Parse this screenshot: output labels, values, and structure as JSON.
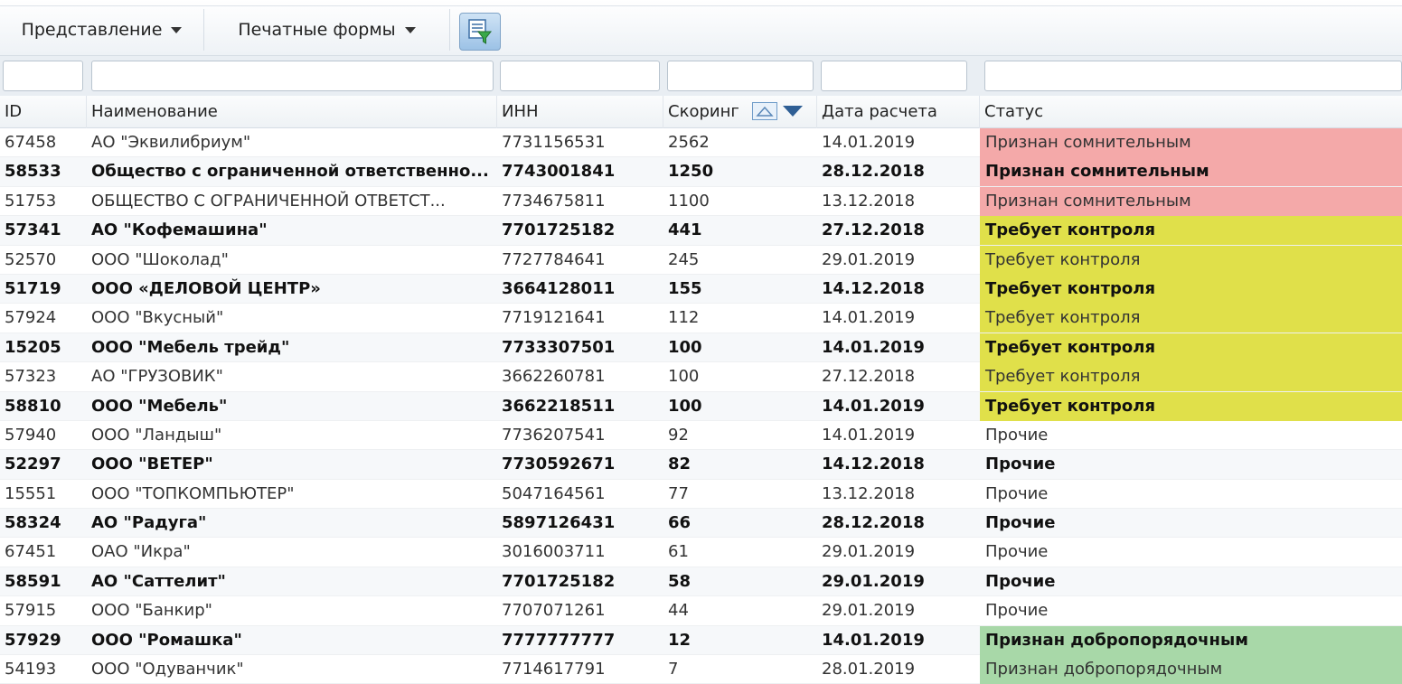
{
  "toolbar": {
    "view_label": "Представление",
    "print_label": "Печатные формы",
    "filter_icon": "filter-settings-icon"
  },
  "filters": {
    "id": "",
    "name": "",
    "inn": "",
    "score": "",
    "date": "",
    "status": ""
  },
  "table": {
    "columns": [
      "ID",
      "Наименование",
      "ИНН",
      "Скоринг",
      "Дата расчета",
      "Статус"
    ],
    "sort": {
      "column": "Скоринг",
      "direction": "desc"
    },
    "status_colors": {
      "Признан сомнительным": "#f4a9a9",
      "Требует контроля": "#e0e04a",
      "Признан добропорядочным": "#a8d8a8",
      "Прочие": "transparent"
    },
    "rows": [
      {
        "id": "67458",
        "name": "АО \"Эквилибриум\"",
        "inn": "7731156531",
        "score": "2562",
        "date": "14.01.2019",
        "status": "Признан сомнительным",
        "bold": false
      },
      {
        "id": "58533",
        "name": "Общество с ограниченной ответственно...",
        "inn": "7743001841",
        "score": "1250",
        "date": "28.12.2018",
        "status": "Признан сомнительным",
        "bold": true
      },
      {
        "id": "51753",
        "name": "ОБЩЕСТВО С ОГРАНИЧЕННОЙ ОТВЕТСТ...",
        "inn": "7734675811",
        "score": "1100",
        "date": "13.12.2018",
        "status": "Признан сомнительным",
        "bold": false
      },
      {
        "id": "57341",
        "name": "АО \"Кофемашина\"",
        "inn": "7701725182",
        "score": "441",
        "date": "27.12.2018",
        "status": "Требует контроля",
        "bold": true
      },
      {
        "id": "52570",
        "name": "ООО \"Шоколад\"",
        "inn": "7727784641",
        "score": "245",
        "date": "29.01.2019",
        "status": "Требует контроля",
        "bold": false
      },
      {
        "id": "51719",
        "name": "ООО «ДЕЛОВОЙ ЦЕНТР»",
        "inn": "3664128011",
        "score": "155",
        "date": "14.12.2018",
        "status": "Требует контроля",
        "bold": true
      },
      {
        "id": "57924",
        "name": "ООО \"Вкусный\"",
        "inn": "7719121641",
        "score": "112",
        "date": "14.01.2019",
        "status": "Требует контроля",
        "bold": false
      },
      {
        "id": "15205",
        "name": "ООО \"Мебель трейд\"",
        "inn": "7733307501",
        "score": "100",
        "date": "14.01.2019",
        "status": "Требует контроля",
        "bold": true
      },
      {
        "id": "57323",
        "name": "АО \"ГРУЗОВИК\"",
        "inn": "3662260781",
        "score": "100",
        "date": "27.12.2018",
        "status": "Требует контроля",
        "bold": false
      },
      {
        "id": "58810",
        "name": "ООО \"Мебель\"",
        "inn": "3662218511",
        "score": "100",
        "date": "14.01.2019",
        "status": "Требует контроля",
        "bold": true
      },
      {
        "id": "57940",
        "name": "ООО \"Ландыш\"",
        "inn": "7736207541",
        "score": "92",
        "date": "14.01.2019",
        "status": "Прочие",
        "bold": false
      },
      {
        "id": "52297",
        "name": "ООО \"ВЕТЕР\"",
        "inn": "7730592671",
        "score": "82",
        "date": "14.12.2018",
        "status": "Прочие",
        "bold": true
      },
      {
        "id": "15551",
        "name": "ООО \"ТОПКОМПЬЮТЕР\"",
        "inn": "5047164561",
        "score": "77",
        "date": "13.12.2018",
        "status": "Прочие",
        "bold": false
      },
      {
        "id": "58324",
        "name": "АО \"Радуга\"",
        "inn": "5897126431",
        "score": "66",
        "date": "28.12.2018",
        "status": "Прочие",
        "bold": true
      },
      {
        "id": "67451",
        "name": "ОАО \"Икра\"",
        "inn": "3016003711",
        "score": "61",
        "date": "29.01.2019",
        "status": "Прочие",
        "bold": false
      },
      {
        "id": "58591",
        "name": "АО \"Саттелит\"",
        "inn": "7701725182",
        "score": "58",
        "date": "29.01.2019",
        "status": "Прочие",
        "bold": true
      },
      {
        "id": "57915",
        "name": "ООО \"Банкир\"",
        "inn": "7707071261",
        "score": "44",
        "date": "29.01.2019",
        "status": "Прочие",
        "bold": false
      },
      {
        "id": "57929",
        "name": "ООО \"Ромашка\"",
        "inn": "7777777777",
        "score": "12",
        "date": "14.01.2019",
        "status": "Признан добропорядочным",
        "bold": true
      },
      {
        "id": "54193",
        "name": "ООО \"Одуванчик\"",
        "inn": "7714617791",
        "score": "7",
        "date": "28.01.2019",
        "status": "Признан добропорядочным",
        "bold": false
      }
    ]
  }
}
